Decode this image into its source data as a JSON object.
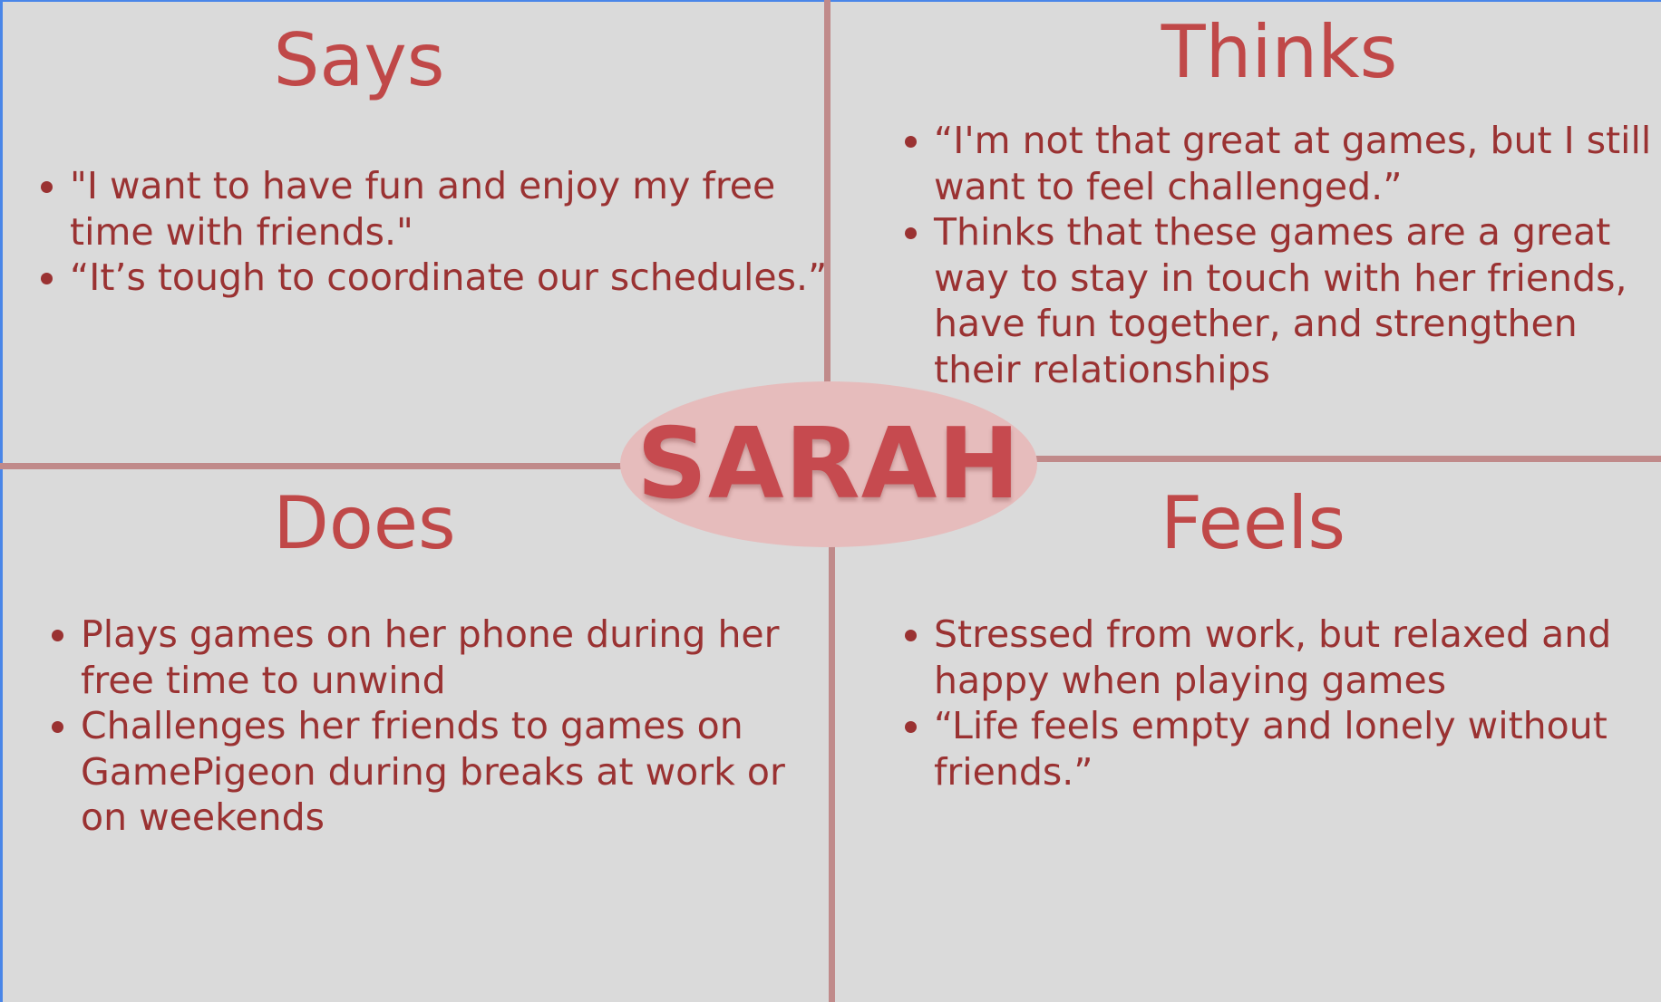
{
  "center": {
    "name": "SARAH"
  },
  "quadrants": {
    "says": {
      "title": "Says",
      "items": [
        "\"I want to have fun and enjoy my free time with friends.\"",
        "“It’s tough to coordinate our schedules.”"
      ]
    },
    "thinks": {
      "title": "Thinks",
      "items": [
        "“I'm not that great at games, but I still want to feel challenged.”",
        "Thinks that these games are a great way to stay in touch with her friends, have fun together, and strengthen their relationships"
      ]
    },
    "does": {
      "title": "Does",
      "items": [
        "Plays games on her phone during her free time to unwind",
        "Challenges her friends to games on GamePigeon during breaks at work or on weekends"
      ]
    },
    "feels": {
      "title": "Feels",
      "items": [
        "Stressed from work, but relaxed and happy when playing games",
        "“Life feels empty and lonely without friends.”"
      ]
    }
  },
  "colors": {
    "background": "#dadada",
    "heading": "#c04848",
    "body_text": "#9a3232",
    "divider": "#c08a8a",
    "center_fill": "#e6bcbc",
    "center_text": "#c64a4f"
  }
}
